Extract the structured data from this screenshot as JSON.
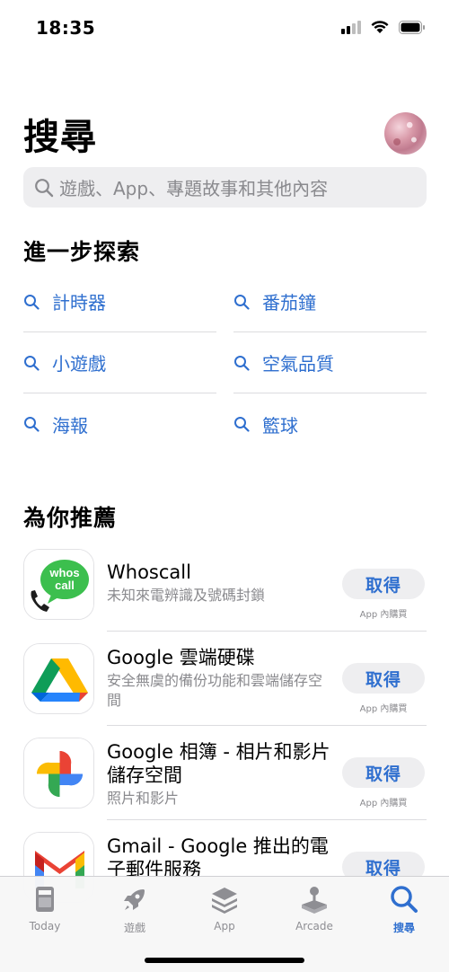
{
  "status_bar": {
    "time": "18:35"
  },
  "header": {
    "title": "搜尋"
  },
  "search": {
    "placeholder": "遊戲、App、專題故事和其他內容"
  },
  "explore": {
    "title": "進一步探索",
    "items": [
      "計時器",
      "番茄鐘",
      "小遊戲",
      "空氣品質",
      "海報",
      "籃球"
    ]
  },
  "recommended": {
    "title": "為你推薦",
    "get_label": "取得",
    "iap_label": "App 內購買",
    "apps": [
      {
        "name": "Whoscall",
        "subtitle": "未知來電辨識及號碼封鎖",
        "icon_text_1": "whos",
        "icon_text_2": "call"
      },
      {
        "name": "Google 雲端硬碟",
        "subtitle": "安全無虞的備份功能和雲端儲存空間"
      },
      {
        "name": "Google 相簿 - 相片和影片儲存空間",
        "subtitle": "照片和影片"
      },
      {
        "name": "Gmail - Google 推出的電子郵件服務",
        "subtitle": ""
      }
    ]
  },
  "tabs": [
    {
      "label": "Today",
      "icon": "today-icon"
    },
    {
      "label": "遊戲",
      "icon": "rocket-icon"
    },
    {
      "label": "App",
      "icon": "layers-icon"
    },
    {
      "label": "Arcade",
      "icon": "arcade-joystick-icon"
    },
    {
      "label": "搜尋",
      "icon": "search-icon",
      "active": true
    }
  ],
  "colors": {
    "accent": "#2f6fcf",
    "secondary_text": "#8a8a8e"
  }
}
